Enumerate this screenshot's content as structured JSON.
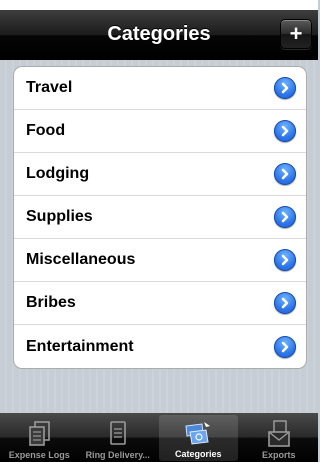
{
  "navbar": {
    "title": "Categories",
    "add_button_label": "+"
  },
  "categories": [
    {
      "label": "Travel"
    },
    {
      "label": "Food"
    },
    {
      "label": "Lodging"
    },
    {
      "label": "Supplies"
    },
    {
      "label": "Miscellaneous"
    },
    {
      "label": "Bribes"
    },
    {
      "label": "Entertainment"
    }
  ],
  "tabbar": {
    "selected": "Categories",
    "tabs": [
      {
        "label": "Expense Logs",
        "icon": "expense-logs-icon"
      },
      {
        "label": "Ring Delivery...",
        "icon": "document-icon"
      },
      {
        "label": "Categories",
        "icon": "categories-icon"
      },
      {
        "label": "Exports",
        "icon": "exports-icon"
      }
    ]
  },
  "colors": {
    "disclosure_blue": "#2c74e8",
    "background": "#c5ccd4",
    "navbar": "#000000"
  }
}
